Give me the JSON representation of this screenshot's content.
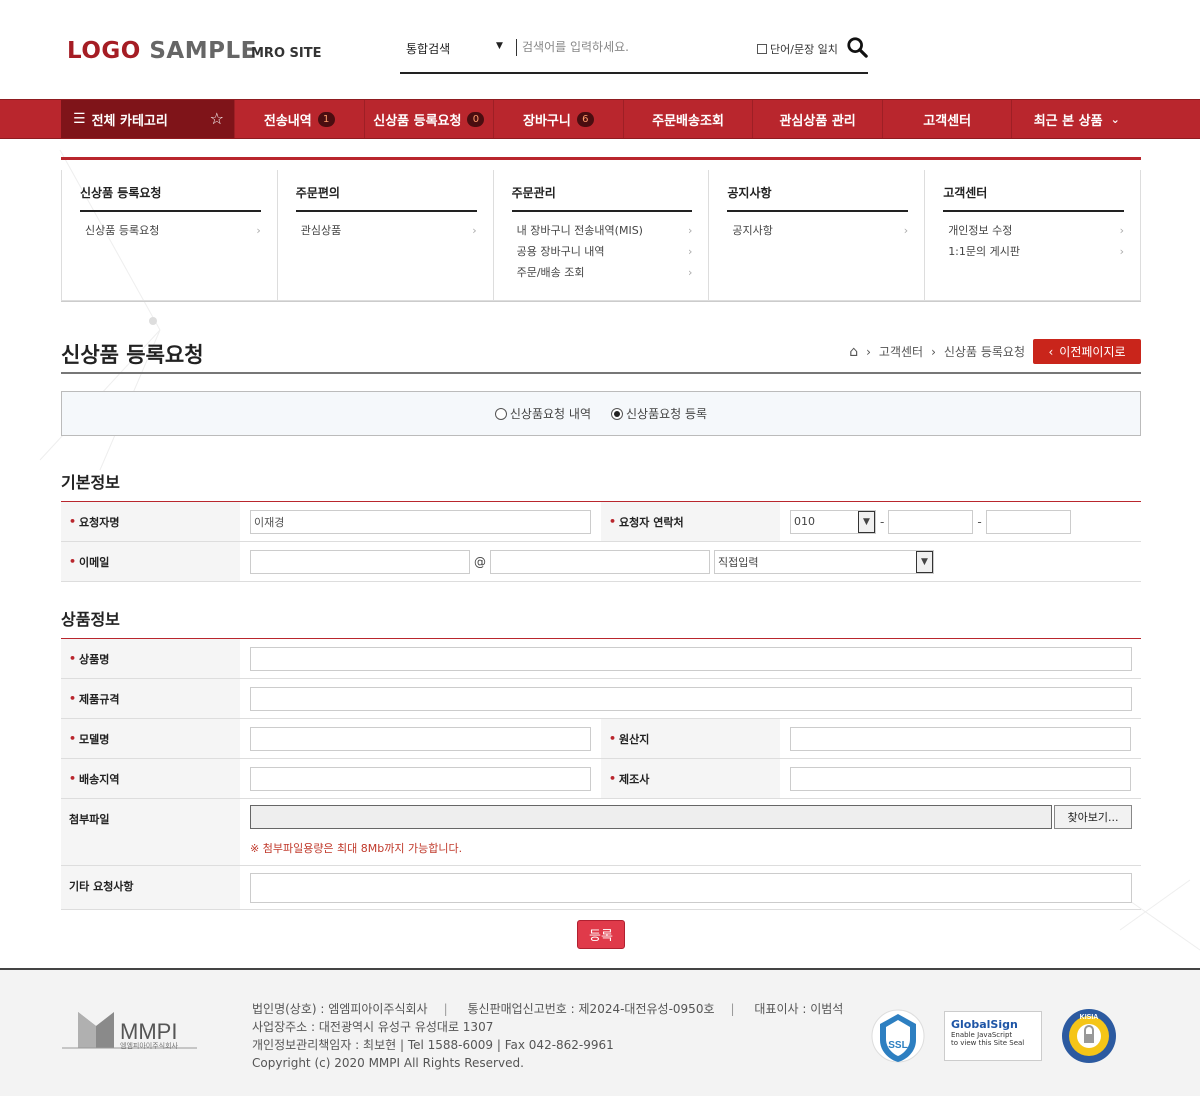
{
  "header": {
    "logo_main": "LOGO",
    "logo_sub": "SAMPLE",
    "site_label": "MRO SITE",
    "search_scope": "통합검색",
    "search_placeholder": "검색어를 입력하세요.",
    "exact_match_label": "단어/문장 일치"
  },
  "nav": {
    "all_categories": "전체 카테고리",
    "items": [
      {
        "label": "전송내역",
        "badge": "1"
      },
      {
        "label": "신상품 등록요청",
        "badge": "0"
      },
      {
        "label": "장바구니",
        "badge": "6"
      },
      {
        "label": "주문배송조회",
        "badge": ""
      },
      {
        "label": "관심상품 관리",
        "badge": ""
      },
      {
        "label": "고객센터",
        "badge": ""
      },
      {
        "label": "최근 본 상품",
        "badge": ""
      }
    ]
  },
  "mega_menu": [
    {
      "title": "신상품 등록요청",
      "links": [
        "신상품 등록요청"
      ]
    },
    {
      "title": "주문편의",
      "links": [
        "관심상품"
      ]
    },
    {
      "title": "주문관리",
      "links": [
        "내 장바구니 전송내역(MIS)",
        "공용 장바구니 내역",
        "주문/배송 조회"
      ]
    },
    {
      "title": "공지사항",
      "links": [
        "공지사항"
      ]
    },
    {
      "title": "고객센터",
      "links": [
        "개인정보 수정",
        "1:1문의 게시판"
      ]
    }
  ],
  "page": {
    "title": "신상품 등록요청",
    "breadcrumb": [
      "고객센터",
      "신상품 등록요청"
    ],
    "back_button": "이전페이지로",
    "tabs": [
      {
        "label": "신상품요청 내역",
        "selected": false
      },
      {
        "label": "신상품요청 등록",
        "selected": true
      }
    ]
  },
  "basic_info": {
    "section_title": "기본정보",
    "requester_label": "요청자명",
    "requester_value": "이재경",
    "contact_label": "요청자 연락처",
    "phone_prefix": "010",
    "email_label": "이메일",
    "email_domain_select": "직접입력",
    "at_sign": "@",
    "dash": "-"
  },
  "product_info": {
    "section_title": "상품정보",
    "name_label": "상품명",
    "spec_label": "제품규격",
    "model_label": "모델명",
    "origin_label": "원산지",
    "region_label": "배송지역",
    "maker_label": "제조사",
    "attach_label": "첨부파일",
    "browse_button": "찾아보기...",
    "attach_note": "※ 첨부파일용량은 최대 8Mb까지 가능합니다.",
    "etc_label": "기타 요청사항"
  },
  "submit_label": "등록",
  "footer": {
    "brand": "MMPI",
    "brand_sub": "엠엠피아이주식회사",
    "line1_a": "법인명(상호) : 엠엠피아이주식회사",
    "line1_b": "통신판매업신고번호 : 제2024-대전유성-0950호",
    "line1_c": "대표이사 : 이범석",
    "line2": "사업장주소 : 대전광역시 유성구 유성대로 1307",
    "line3": "개인정보관리책임자 : 최보현 | Tel 1588-6009 | Fax 042-862-9961",
    "line4": "Copyright (c) 2020 MMPI All Rights Reserved.",
    "seal_ssl": "SSL",
    "seal_gs_title": "GlobalSign",
    "seal_gs_text1": "Enable JavaScript",
    "seal_gs_text2": "to view this Site Seal",
    "seal_kisia": "KISIA"
  },
  "colors": {
    "brand_red": "#b9262d",
    "dark_red": "#7f1419",
    "button_red": "#c9251b"
  }
}
